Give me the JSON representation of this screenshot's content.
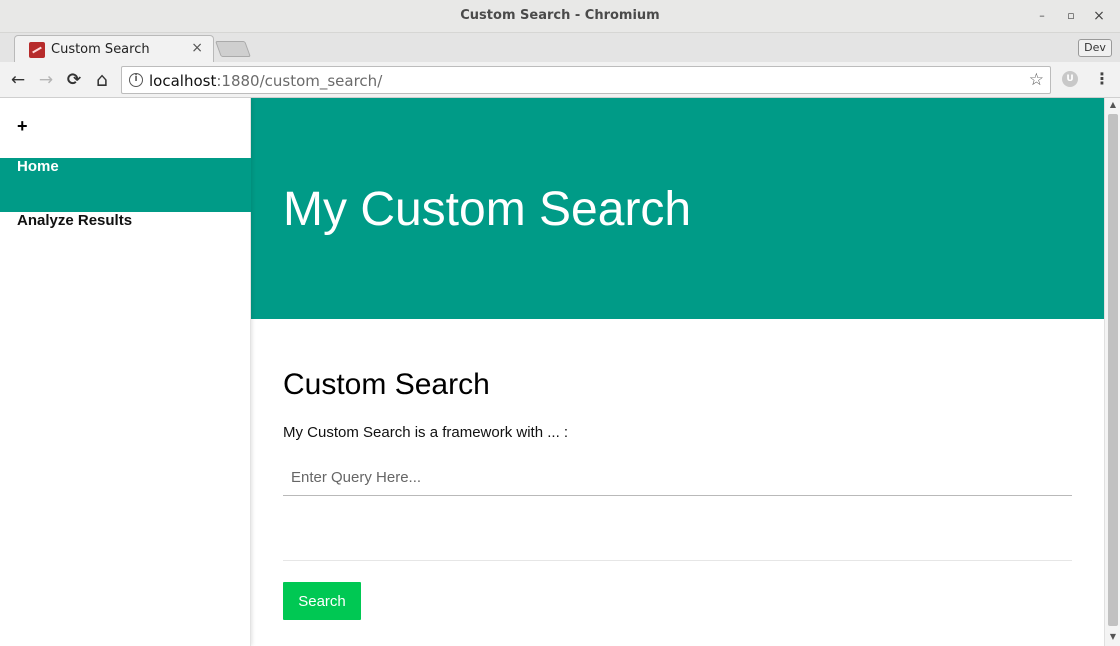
{
  "window": {
    "title": "Custom Search - Chromium",
    "minimize_glyph": "–",
    "maximize_glyph": "▫",
    "close_glyph": "×"
  },
  "tabs": [
    {
      "label": "Custom Search",
      "close_glyph": "×"
    }
  ],
  "browser": {
    "dev_badge": "Dev",
    "url_host": "localhost",
    "url_path": ":1880/custom_search/",
    "back_glyph": "←",
    "forward_glyph": "→",
    "reload_glyph": "⟳",
    "home_glyph": "⌂",
    "info_glyph": "i",
    "star_glyph": "☆",
    "extension_glyph": "U",
    "menu_glyph": "⋮"
  },
  "sidebar": {
    "plus_label": "+",
    "items": [
      {
        "label": "Home",
        "active": true
      },
      {
        "label": "Analyze Results",
        "active": false
      }
    ]
  },
  "hero": {
    "title": "My Custom Search",
    "background": "#009b87"
  },
  "content": {
    "heading": "Custom Search",
    "description": "My Custom Search is a framework with ... :",
    "query_placeholder": "Enter Query Here...",
    "query_value": "",
    "search_button_label": "Search",
    "search_button_color": "#00c853"
  },
  "scrollbar": {
    "up_glyph": "▲",
    "down_glyph": "▼"
  }
}
